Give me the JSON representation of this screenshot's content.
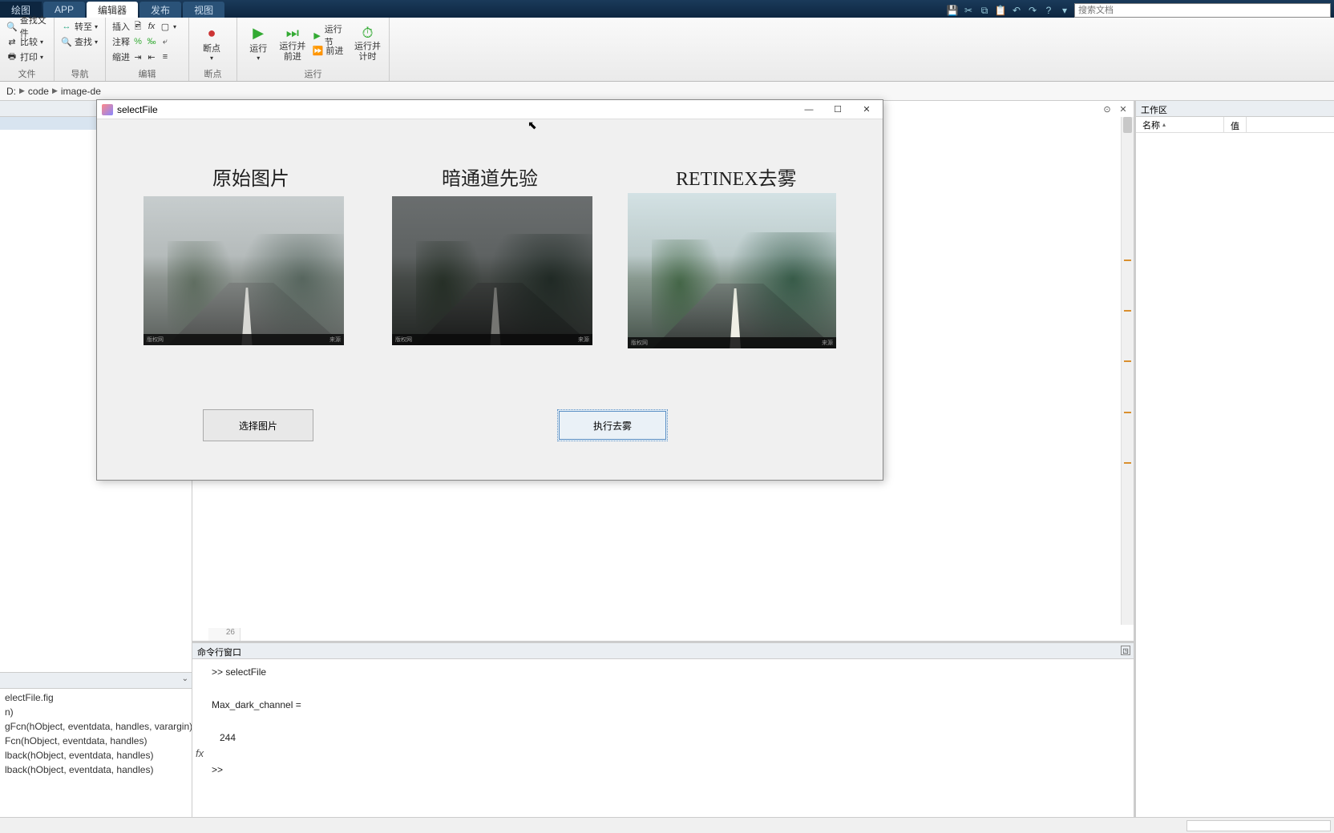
{
  "tabs": {
    "t0": "绘图",
    "t1": "APP",
    "t2": "编辑器",
    "t3": "发布",
    "t4": "视图"
  },
  "search_placeholder": "搜索文档",
  "ribbon": {
    "g1": {
      "open": "查找文件",
      "compare": "比较",
      "print": "打印",
      "label": "文件"
    },
    "g2": {
      "goto": "转至",
      "find": "查找",
      "label": "导航"
    },
    "g3": {
      "insert": "插入",
      "comment": "注释",
      "indent": "缩进",
      "label": "编辑"
    },
    "g4": {
      "bp": "断点",
      "label": "断点"
    },
    "g5": {
      "run": "运行",
      "runadv": "运行并\n前进",
      "runsec": "运行节",
      "step": "前进",
      "runtimer": "运行并\n计时",
      "label": "运行"
    }
  },
  "path": {
    "p0": "D:",
    "p1": "code",
    "p2": "image-de"
  },
  "figwin": {
    "title": "selectFile",
    "t1": "原始图片",
    "t2": "暗通道先验",
    "t3": "RETINEX去雾",
    "btn_select": "选择图片",
    "btn_run": "执行去雾",
    "wm_l": "版权网",
    "wm_r": "来源"
  },
  "cmd": {
    "title": "命令行窗口",
    "line1": ">> selectFile",
    "line2": "Max_dark_channel =",
    "line3": "   244",
    "prompt": ">> "
  },
  "editor": {
    "lineno": "26"
  },
  "ws": {
    "title": "工作区",
    "col_name": "名称",
    "col_val": "值"
  },
  "outline": {
    "f0": "electFile.fig",
    "f1": "n)",
    "f2": "gFcn(hObject, eventdata, handles, varargin)",
    "f3": "Fcn(hObject, eventdata, handles)",
    "f4": "lback(hObject, eventdata, handles)",
    "f5": "lback(hObject, eventdata, handles)"
  }
}
